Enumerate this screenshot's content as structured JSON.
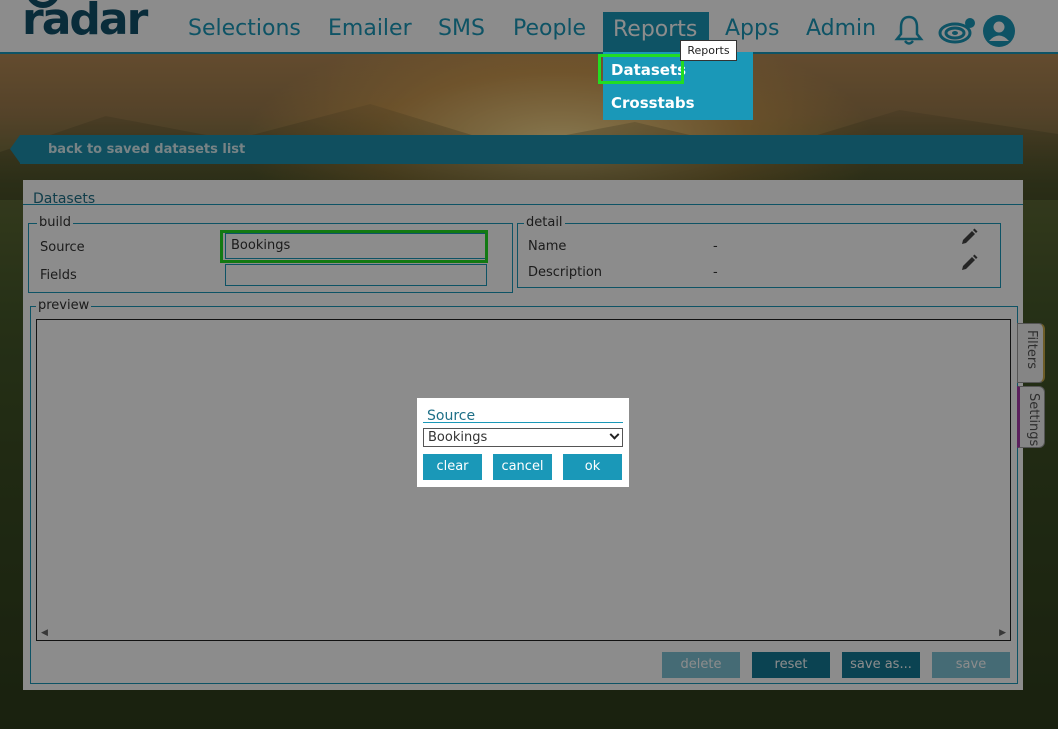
{
  "nav": {
    "logo": "radar",
    "items": [
      "Selections",
      "Emailer",
      "SMS",
      "People",
      "Reports",
      "Apps",
      "Admin"
    ],
    "tooltip": "Reports"
  },
  "reports_menu": {
    "items": [
      "Datasets",
      "Crosstabs"
    ]
  },
  "back_link": "back to saved datasets list",
  "panel": {
    "title": "Datasets",
    "build": {
      "legend": "build",
      "source_label": "Source",
      "source_value": "Bookings",
      "fields_label": "Fields"
    },
    "detail": {
      "legend": "detail",
      "name_label": "Name",
      "name_value": "-",
      "description_label": "Description",
      "description_value": "-"
    },
    "preview": {
      "legend": "preview",
      "side_tabs": [
        "Filters",
        "Settings"
      ]
    },
    "buttons": {
      "delete": "delete",
      "reset": "reset",
      "save_as": "save as...",
      "save": "save"
    }
  },
  "modal": {
    "title": "Source",
    "selected": "Bookings",
    "clear": "clear",
    "cancel": "cancel",
    "ok": "ok"
  },
  "colors": {
    "accent": "#1a98b8",
    "brand_dark": "#11506b",
    "highlight": "#22dd22"
  }
}
